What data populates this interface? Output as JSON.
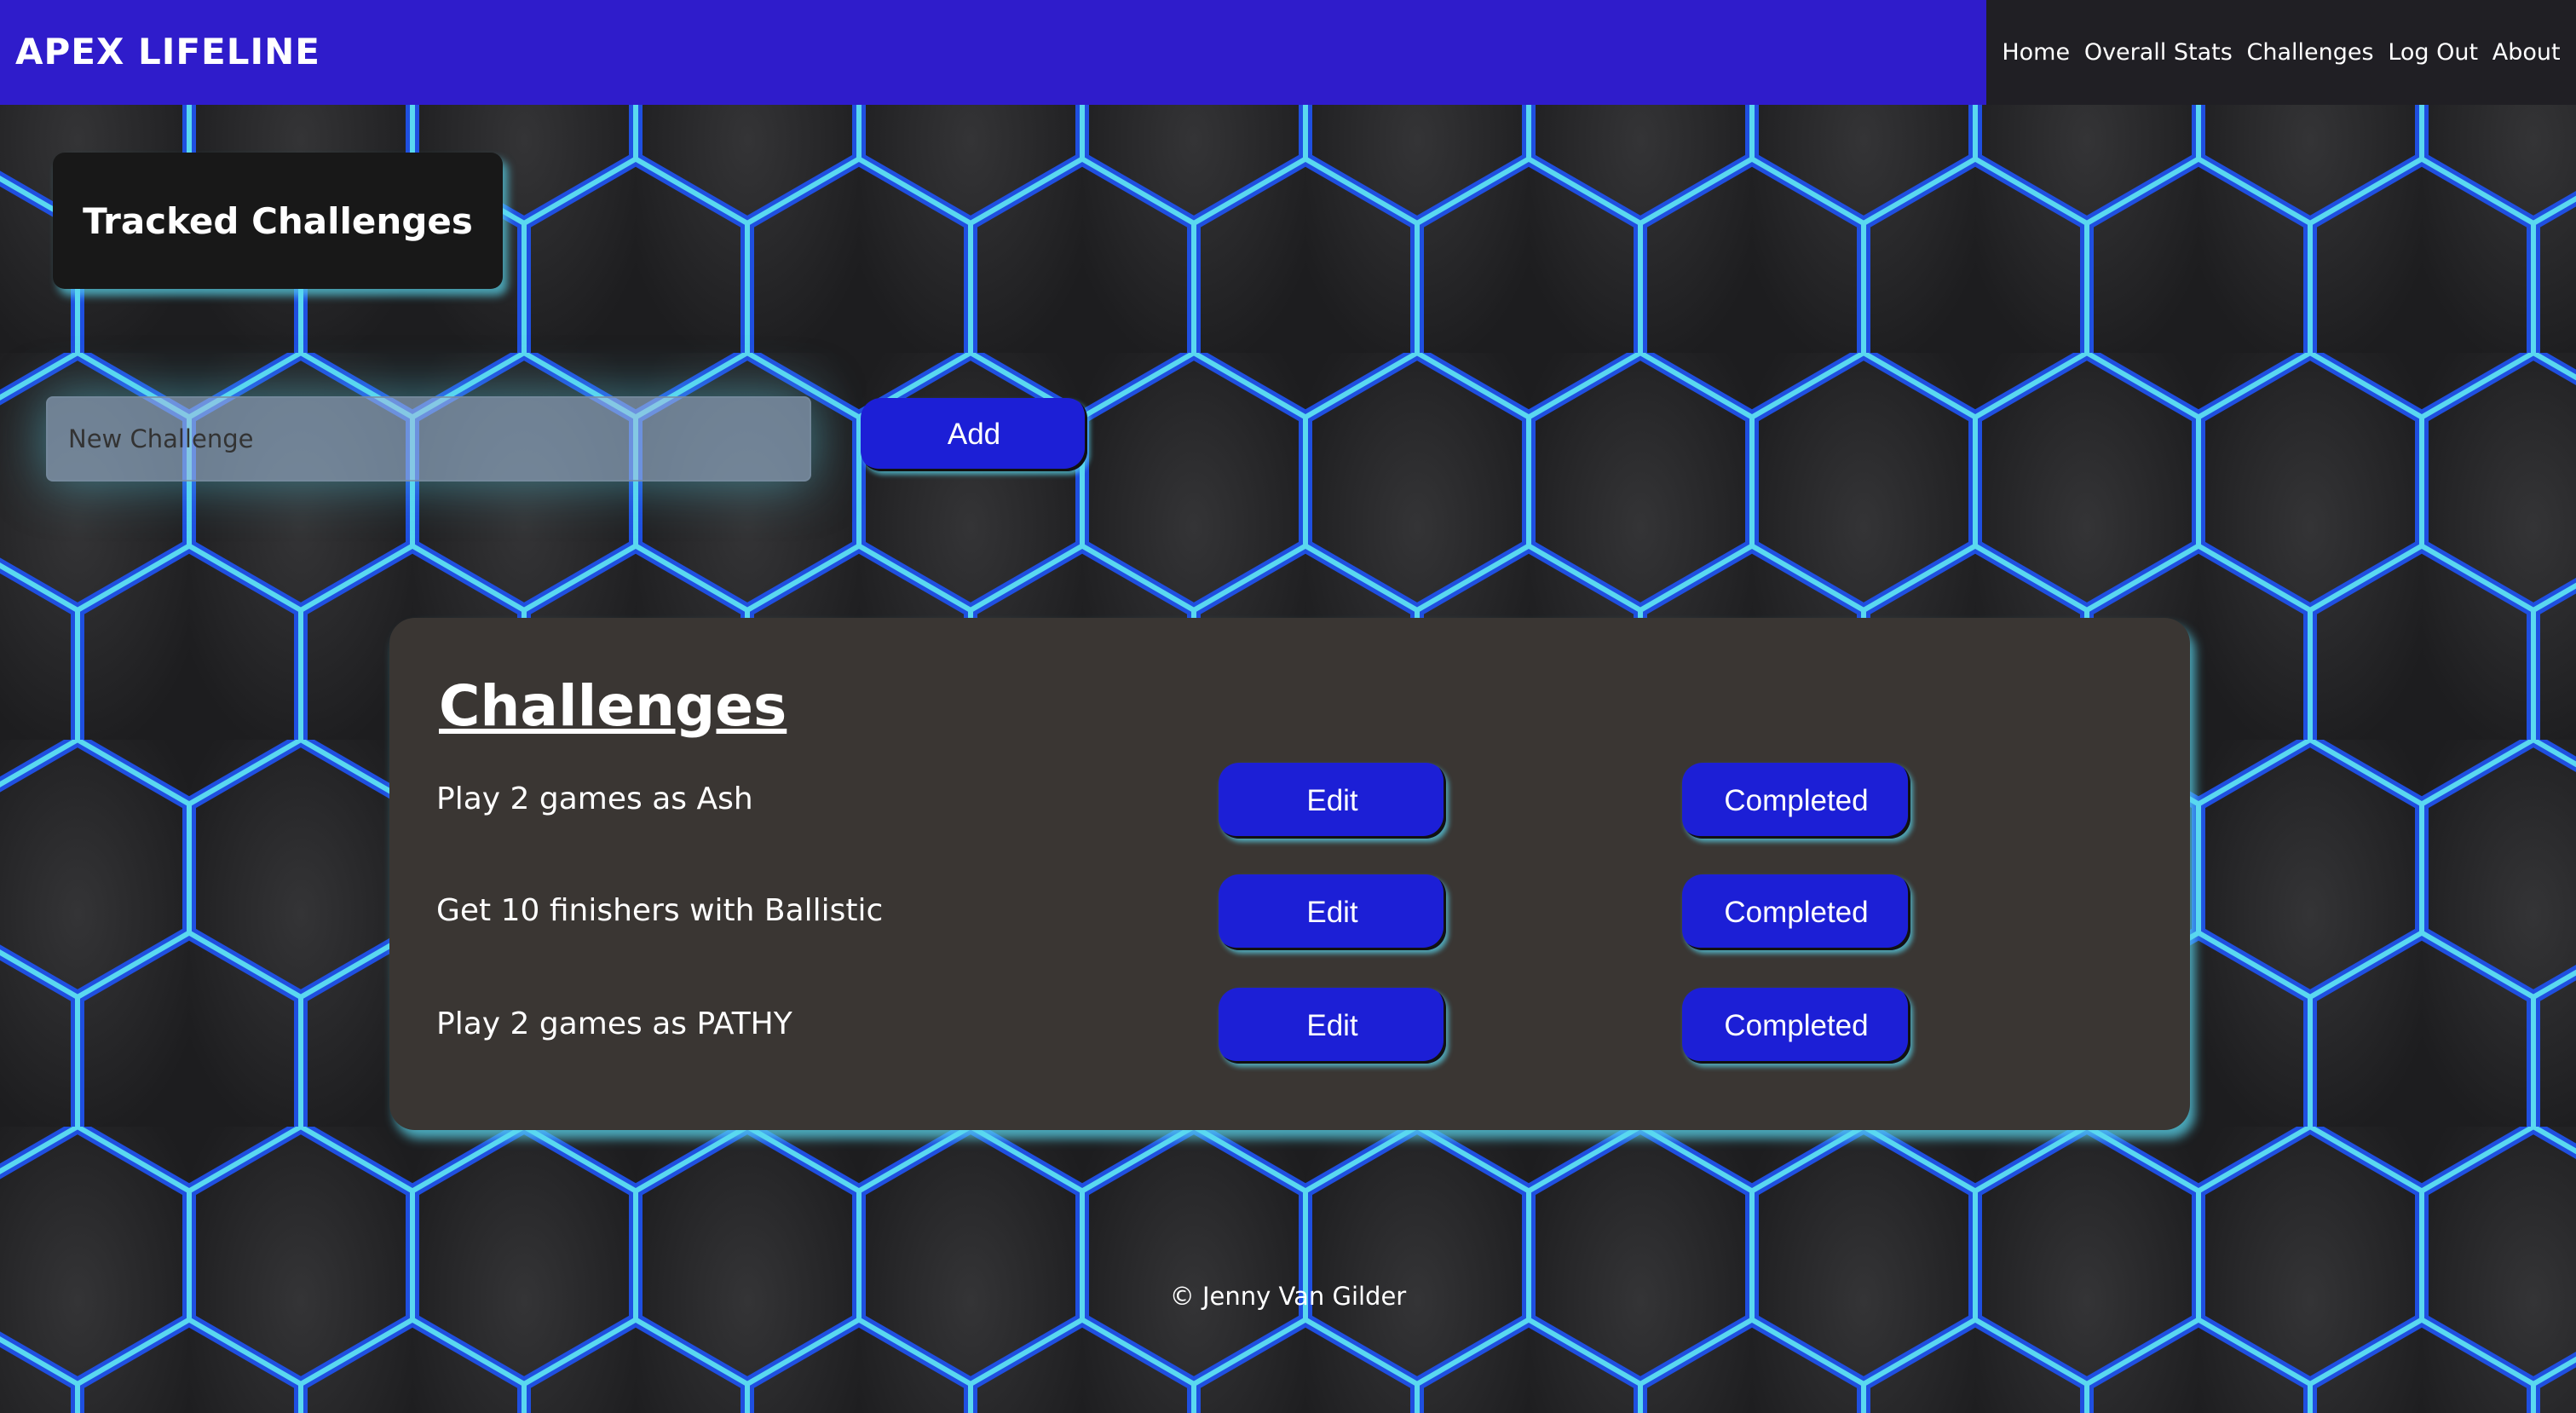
{
  "header": {
    "brand": "APEX LIFELINE",
    "nav": [
      "Home",
      "Overall Stats",
      "Challenges",
      "Log Out",
      "About"
    ]
  },
  "page_title": "Tracked Challenges",
  "new_challenge": {
    "placeholder": "New Challenge",
    "value": "",
    "add_label": "Add"
  },
  "challenges": {
    "heading": "Challenges",
    "items": [
      {
        "text": "Play 2 games as Ash",
        "edit": "Edit",
        "complete": "Completed"
      },
      {
        "text": "Get 10 finishers with Ballistic",
        "edit": "Edit",
        "complete": "Completed"
      },
      {
        "text": "Play 2 games as PATHY",
        "edit": "Edit",
        "complete": "Completed"
      }
    ]
  },
  "footer": "© Jenny Van Gilder",
  "colors": {
    "nav": "#2f1ccb",
    "button": "#1c1fd6",
    "glow": "#5ad8f0",
    "panel": "#3a3633"
  }
}
